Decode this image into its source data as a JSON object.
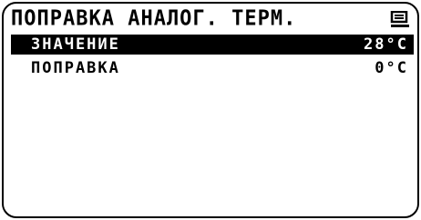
{
  "header": {
    "title": "ПОПРАВКА АНАЛОГ. ТЕРМ.",
    "icon": "menu-screen-icon"
  },
  "rows": [
    {
      "label": "ЗНАЧЕНИЕ",
      "value": "28°C",
      "selected": true
    },
    {
      "label": "ПОПРАВКА",
      "value": "0°C",
      "selected": false
    }
  ],
  "colors": {
    "foreground": "#000000",
    "background": "#ffffff",
    "selection": "#000000"
  }
}
